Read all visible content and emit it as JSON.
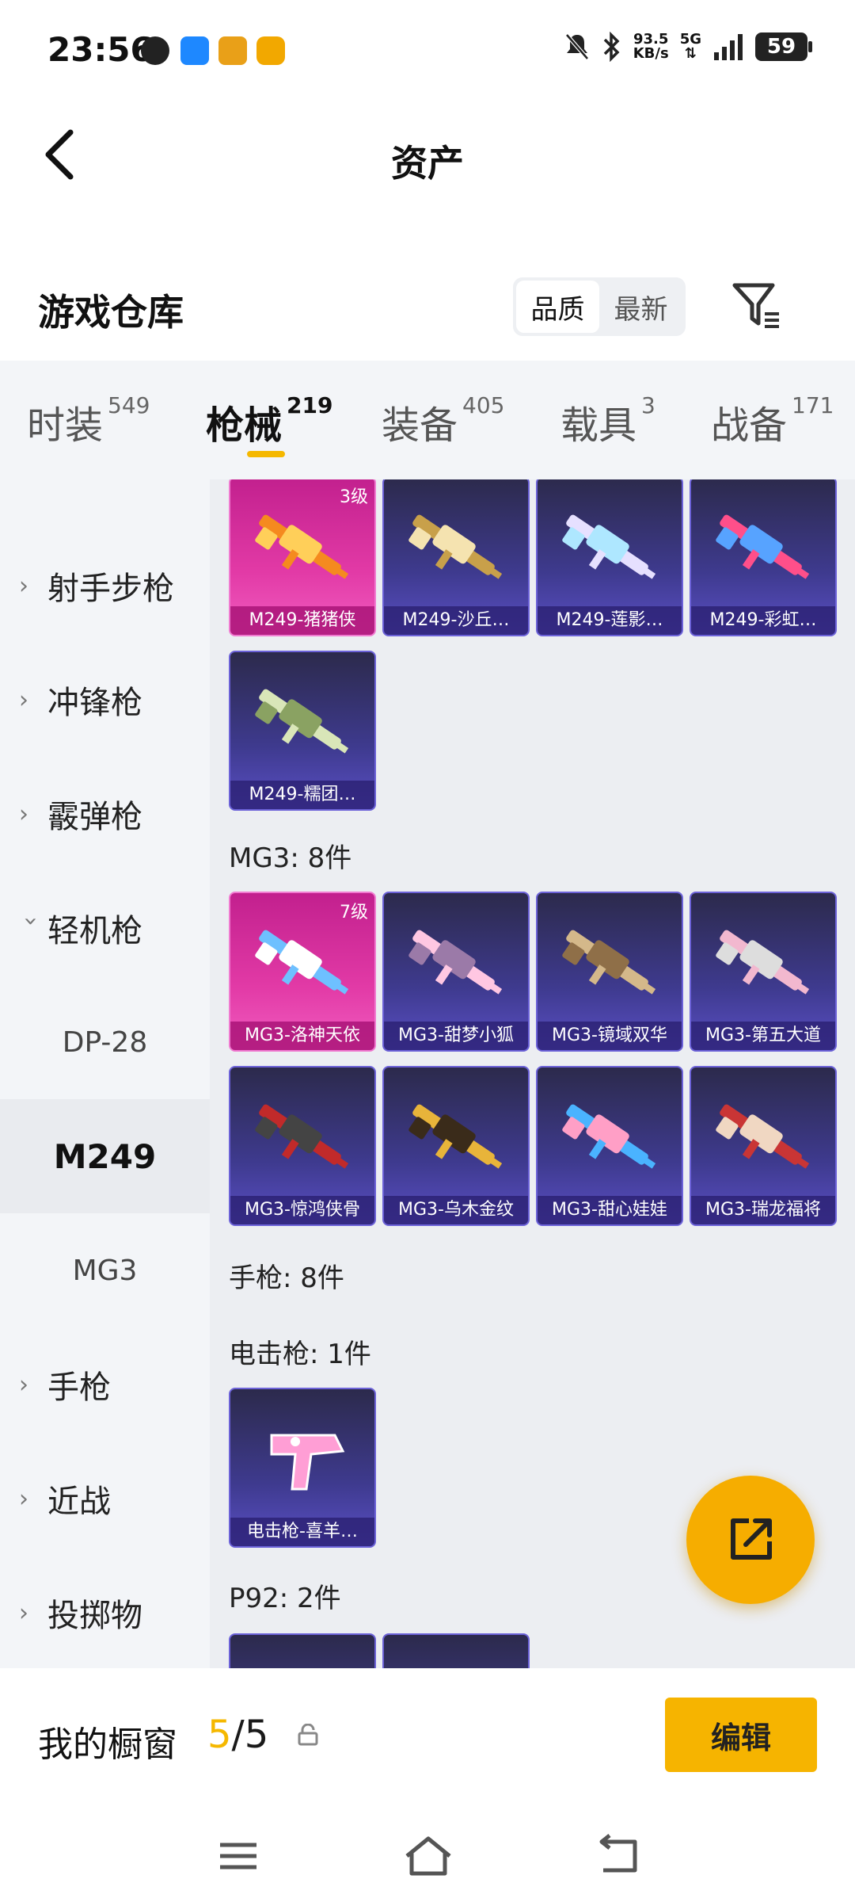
{
  "status_bar": {
    "time": "23:56",
    "net_speed_value": "93.5",
    "net_speed_unit": "KB/s",
    "network": "5G",
    "battery": "59"
  },
  "header": {
    "title": "资产"
  },
  "warehouse": {
    "title": "游戏仓库",
    "sort_options": [
      "品质",
      "最新"
    ],
    "active_sort": "品质"
  },
  "tabs": [
    {
      "label": "时装",
      "count": "549"
    },
    {
      "label": "枪械",
      "count": "219",
      "active": true
    },
    {
      "label": "装备",
      "count": "405"
    },
    {
      "label": "载具",
      "count": "3"
    },
    {
      "label": "战备",
      "count": "171"
    }
  ],
  "sidebar": {
    "items": [
      {
        "label": "射手步枪"
      },
      {
        "label": "冲锋枪"
      },
      {
        "label": "霰弹枪"
      },
      {
        "label": "轻机枪",
        "expanded": true
      },
      {
        "label": "手枪"
      },
      {
        "label": "近战"
      },
      {
        "label": "投掷物"
      }
    ],
    "sub_items": [
      "DP-28",
      "M249",
      "MG3"
    ],
    "selected_sub": "M249"
  },
  "sections": {
    "m249_cards": [
      {
        "name": "M249-猪猪侠",
        "level": "3级",
        "pink": true
      },
      {
        "name": "M249-沙丘…"
      },
      {
        "name": "M249-莲影…"
      },
      {
        "name": "M249-彩虹…"
      },
      {
        "name": "M249-糯团…"
      }
    ],
    "mg3_title": "MG3: 8件",
    "mg3_cards": [
      {
        "name": "MG3-洛神天依",
        "level": "7级",
        "pink": true
      },
      {
        "name": "MG3-甜梦小狐"
      },
      {
        "name": "MG3-镜域双华"
      },
      {
        "name": "MG3-第五大道"
      },
      {
        "name": "MG3-惊鸿侠骨"
      },
      {
        "name": "MG3-乌木金纹"
      },
      {
        "name": "MG3-甜心娃娃"
      },
      {
        "name": "MG3-瑞龙福将"
      }
    ],
    "pistol_title": "手枪: 8件",
    "stun_title": "电击枪: 1件",
    "stun_cards": [
      {
        "name": "电击枪-喜羊…"
      }
    ],
    "p92_title": "P92: 2件"
  },
  "showcase": {
    "title": "我的橱窗",
    "current": "5",
    "total": "/5",
    "edit_label": "编辑"
  },
  "colors": {
    "accent": "#f5b800",
    "card_purple": "#3e3a8e",
    "card_pink": "#e23aa6"
  }
}
